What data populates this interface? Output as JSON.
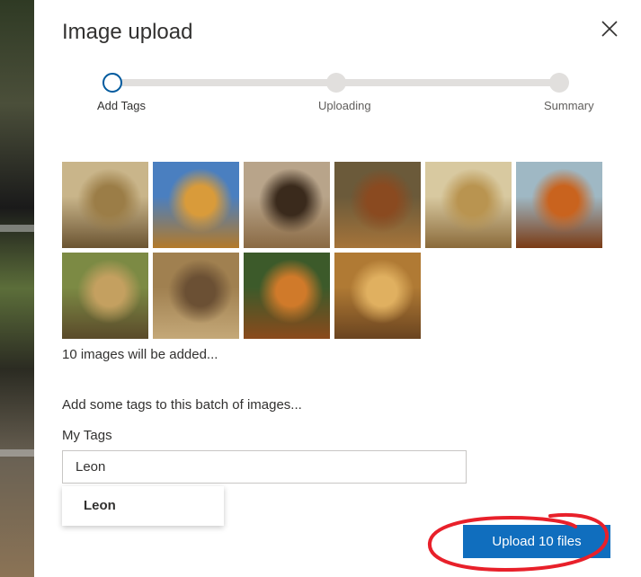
{
  "dialog": {
    "title": "Image upload",
    "close_icon": "close-icon"
  },
  "stepper": {
    "steps": [
      {
        "label": "Add Tags",
        "active": true
      },
      {
        "label": "Uploading",
        "active": false
      },
      {
        "label": "Summary",
        "active": false
      }
    ]
  },
  "images": {
    "thumbnails": [
      {
        "name": "lion-thumb-1",
        "colors": [
          "#c9b58a",
          "#9b7d47",
          "#6b5432"
        ]
      },
      {
        "name": "lion-thumb-2",
        "colors": [
          "#4a7fc0",
          "#d99b3a",
          "#b37a2a"
        ]
      },
      {
        "name": "lion-thumb-3",
        "colors": [
          "#b8a48a",
          "#3a2a1c",
          "#8a6a44"
        ]
      },
      {
        "name": "lion-thumb-4",
        "colors": [
          "#6b5a3a",
          "#8a4a20",
          "#a5743a"
        ]
      },
      {
        "name": "lion-thumb-5",
        "colors": [
          "#d8c9a0",
          "#b99450",
          "#8a6a3a"
        ]
      },
      {
        "name": "lion-thumb-6",
        "colors": [
          "#9fb8c4",
          "#c9631e",
          "#7a3a14"
        ]
      },
      {
        "name": "lion-thumb-7",
        "colors": [
          "#7c8a44",
          "#c4a060",
          "#5a4a2a"
        ]
      },
      {
        "name": "lion-thumb-8",
        "colors": [
          "#a08050",
          "#6b5034",
          "#c4a878"
        ]
      },
      {
        "name": "lion-thumb-9",
        "colors": [
          "#3c5a2a",
          "#d07a2a",
          "#8a4a1c"
        ]
      },
      {
        "name": "lion-thumb-10",
        "colors": [
          "#b07a34",
          "#e0b060",
          "#6a4420"
        ]
      }
    ],
    "count_text": "10 images will be added..."
  },
  "tags": {
    "heading": "Add some tags to this batch of images...",
    "label": "My Tags",
    "input_value": "Leon",
    "suggestion": "Leon"
  },
  "actions": {
    "upload_label": "Upload 10 files"
  },
  "colors": {
    "accent": "#106ebe",
    "annotation": "#e8202a",
    "step_active": "#005a9e"
  }
}
